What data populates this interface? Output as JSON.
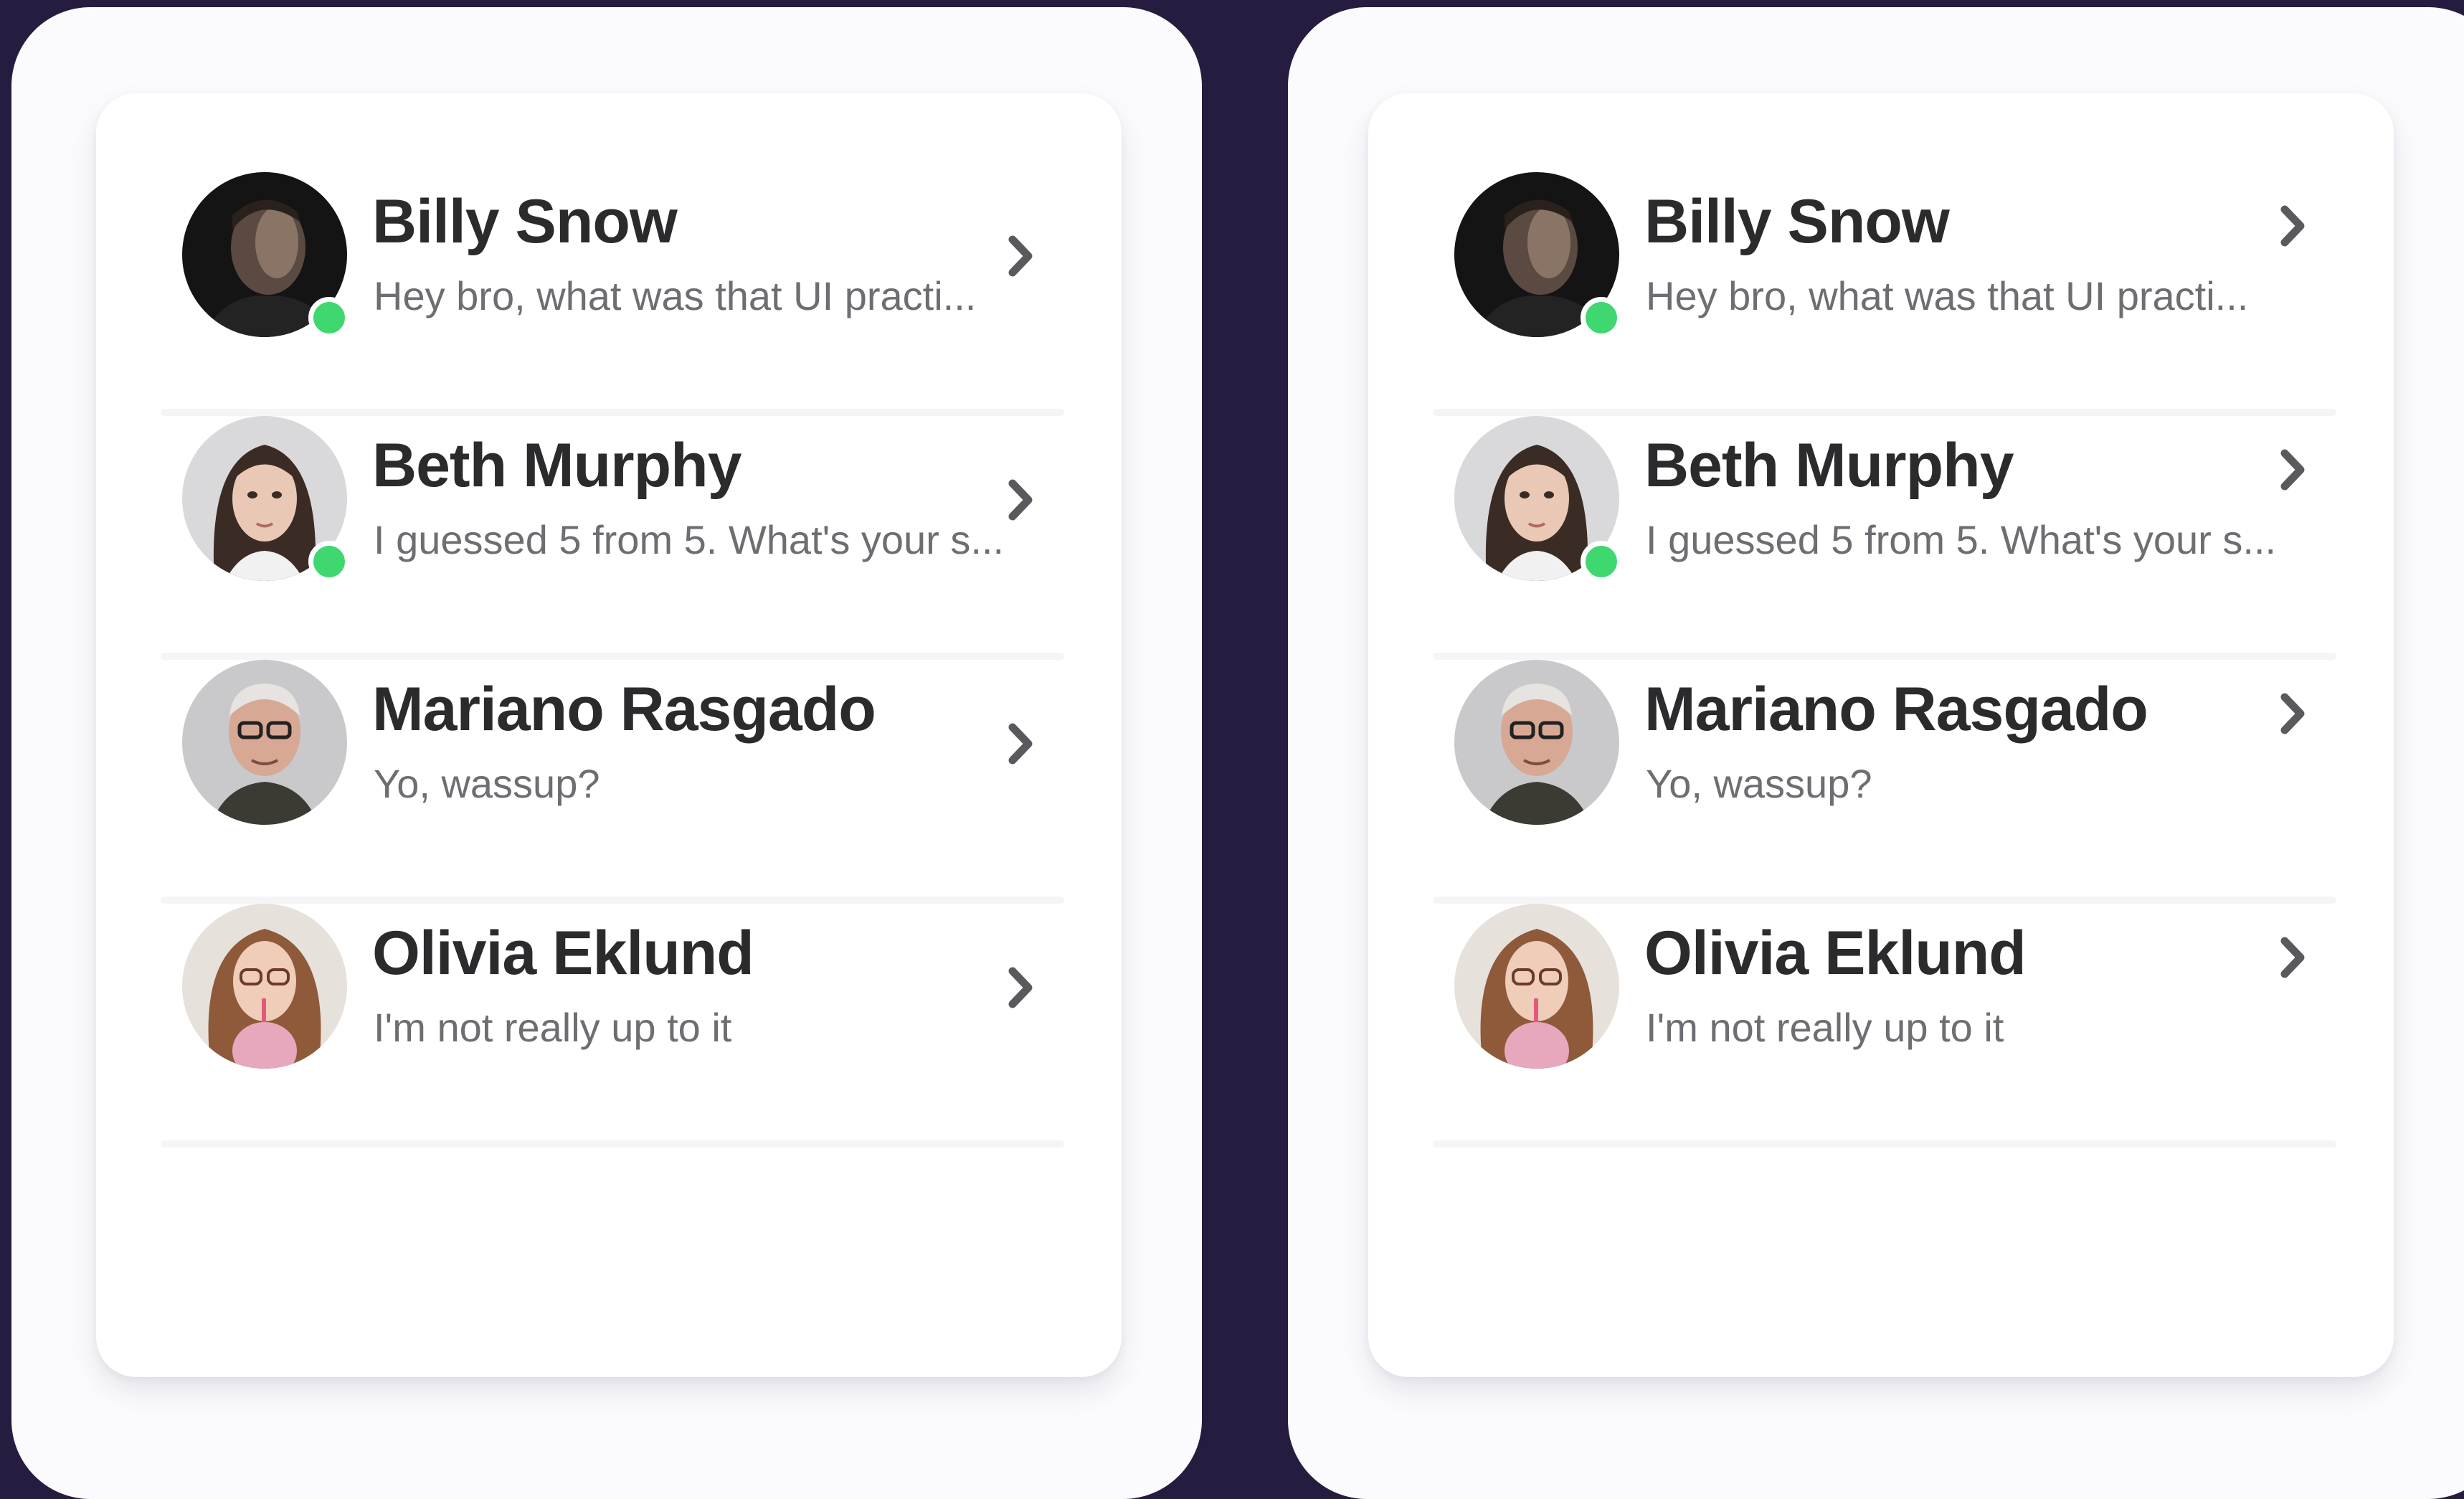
{
  "panels": [
    {
      "chats": [
        {
          "name": "Billy Snow",
          "preview": "Hey bro, what was that UI practi...",
          "online": true,
          "avatar": "avatar-billy"
        },
        {
          "name": "Beth Murphy",
          "preview": "I guessed 5 from 5. What's your s...",
          "online": true,
          "avatar": "avatar-beth"
        },
        {
          "name": "Mariano Rasgado",
          "preview": "Yo, wassup?",
          "online": false,
          "avatar": "avatar-mariano"
        },
        {
          "name": "Olivia Eklund",
          "preview": "I'm not really up to it",
          "online": false,
          "avatar": "avatar-olivia"
        }
      ]
    },
    {
      "chats": [
        {
          "name": "Billy Snow",
          "preview": "Hey bro, what was that UI practi...",
          "online": true,
          "avatar": "avatar-billy"
        },
        {
          "name": "Beth Murphy",
          "preview": "I guessed 5 from 5. What's your s...",
          "online": true,
          "avatar": "avatar-beth"
        },
        {
          "name": "Mariano Rasgado",
          "preview": "Yo, wassup?",
          "online": false,
          "avatar": "avatar-mariano"
        },
        {
          "name": "Olivia Eklund",
          "preview": "I'm not really up to it",
          "online": false,
          "avatar": "avatar-olivia"
        }
      ]
    }
  ],
  "icons": {
    "chevron": "chevron-right-icon",
    "status": "online-status-dot"
  },
  "colors": {
    "background": "#251c3f",
    "panel": "#fbfbfd",
    "card": "#ffffff",
    "online": "#3fd76f",
    "name_text": "#2b2b2e",
    "preview_text": "#6d6d72"
  }
}
